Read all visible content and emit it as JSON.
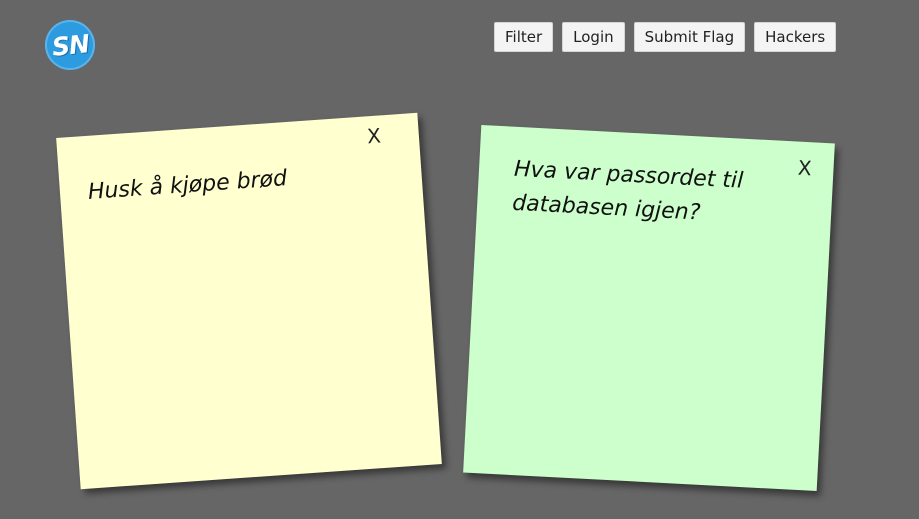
{
  "header": {
    "logo_text": "SN",
    "nav": [
      {
        "label": "Filter"
      },
      {
        "label": "Login"
      },
      {
        "label": "Submit Flag"
      },
      {
        "label": "Hackers"
      }
    ]
  },
  "notes": [
    {
      "text": "Husk å kjøpe brød",
      "close_label": "X",
      "color": "#ffffd0"
    },
    {
      "text": "Hva var passordet til databasen igjen?",
      "close_label": "X",
      "color": "#ccffcc"
    }
  ],
  "colors": {
    "background": "#666666",
    "logo": "#2d9be0"
  }
}
